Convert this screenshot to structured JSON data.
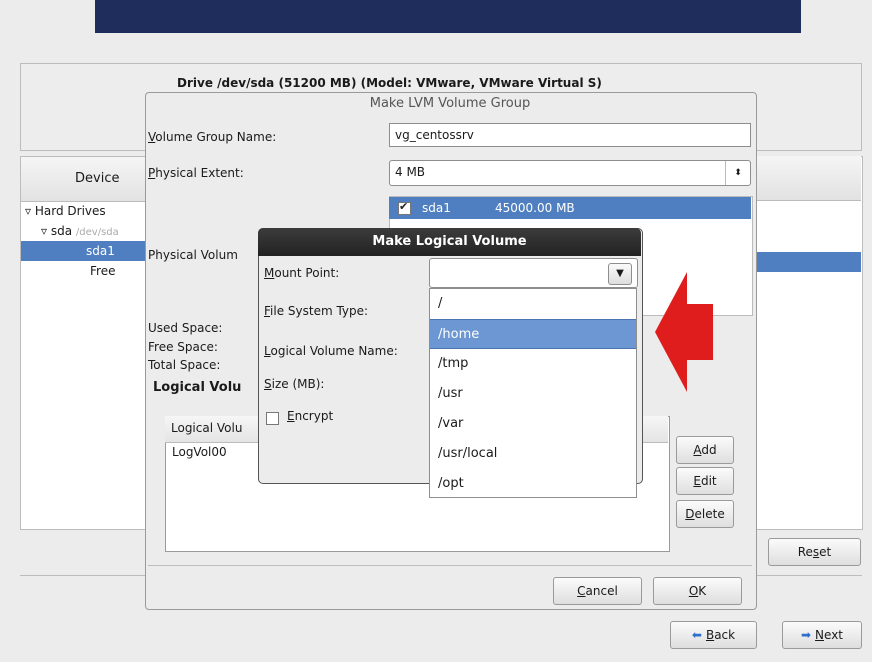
{
  "drive_label": "Drive /dev/sda (51200 MB) (Model: VMware, VMware Virtual S)",
  "device_panel": {
    "header": "Device",
    "tree": [
      "Hard Drives",
      "sda",
      "/dev/sda",
      "sda1",
      "Free"
    ]
  },
  "main_buttons": {
    "reset": "Reset",
    "back": "Back",
    "next": "Next"
  },
  "lvm_dialog": {
    "title": "Make LVM Volume Group",
    "vg_name_label": "Volume Group Name:",
    "vg_name_value": "vg_centossrv",
    "pe_label": "Physical Extent:",
    "pe_value": "4 MB",
    "pv_label": "Physical Volum",
    "pv_row": {
      "name": "sda1",
      "size": "45000.00 MB",
      "checked": true
    },
    "used_space_label": "Used Space:",
    "free_space_label": "Free Space:",
    "total_space_label": "Total Space:",
    "lv_section_label": "Logical Volu",
    "lv_table_header": "Logical Volu",
    "lv_rows": [
      "LogVol00"
    ],
    "add": "Add",
    "edit": "Edit",
    "delete": "Delete",
    "cancel": "Cancel",
    "ok": "OK"
  },
  "mlv_dialog": {
    "title": "Make Logical Volume",
    "mount_point_label": "Mount Point:",
    "fs_type_label": "File System Type:",
    "lv_name_label": "Logical Volume Name:",
    "size_label": "Size (MB):",
    "encrypt_label": "Encrypt",
    "mount_point_value": ""
  },
  "mount_options": [
    "/",
    "/home",
    "/tmp",
    "/usr",
    "/var",
    "/usr/local",
    "/opt"
  ],
  "mount_selected": "/home",
  "colors": {
    "selection": "#4f7fc0",
    "highlight": "#6c97d3",
    "arrow": "#e01d1d",
    "banner": "#1e2d5c"
  }
}
